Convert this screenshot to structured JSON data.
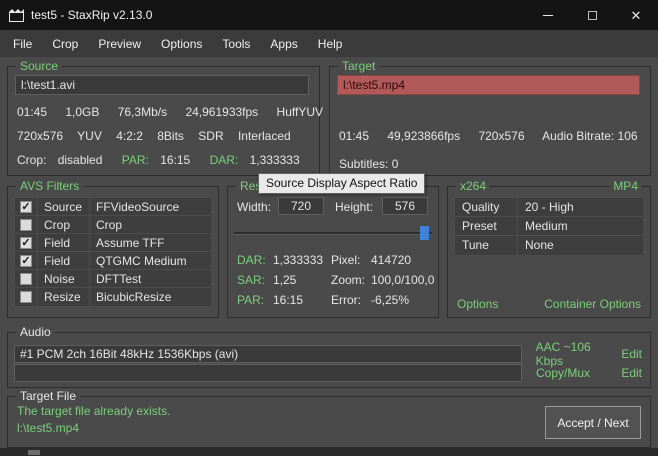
{
  "window": {
    "title": "test5 - StaxRip v2.13.0",
    "close_icon": "✕"
  },
  "menu": {
    "items": [
      "File",
      "Crop",
      "Preview",
      "Options",
      "Tools",
      "Apps",
      "Help"
    ]
  },
  "source": {
    "title": "Source",
    "file": "l:\\test1.avi",
    "info1": [
      "01:45",
      "1,0GB",
      "76,3Mb/s",
      "24,961933fps",
      "HuffYUV"
    ],
    "info2": [
      "720x576",
      "YUV",
      "4:2:2",
      "8Bits",
      "SDR",
      "Interlaced"
    ],
    "crop_label": "Crop:",
    "crop_value": "disabled",
    "par_label": "PAR:",
    "par_value": "16:15",
    "dar_label": "DAR:",
    "dar_value": "1,333333"
  },
  "target": {
    "title": "Target",
    "file": "l:\\test5.mp4",
    "info1": [
      "01:45",
      "49,923866fps",
      "720x576",
      "Audio Bitrate: 106"
    ],
    "subtitles": "Subtitles: 0"
  },
  "filters": {
    "title": "AVS Filters",
    "rows": [
      {
        "check": "✓",
        "name": "Source",
        "value": "FFVideoSource"
      },
      {
        "check": "",
        "name": "Crop",
        "value": "Crop"
      },
      {
        "check": "✓",
        "name": "Field",
        "value": "Assume TFF"
      },
      {
        "check": "✓",
        "name": "Field",
        "value": "QTGMC Medium"
      },
      {
        "check": "",
        "name": "Noise",
        "value": "DFTTest"
      },
      {
        "check": "",
        "name": "Resize",
        "value": "BicubicResize"
      }
    ]
  },
  "resize": {
    "title": "Resize",
    "width_label": "Width:",
    "width_value": "720",
    "height_label": "Height:",
    "height_value": "576",
    "stats": [
      {
        "l1": "DAR:",
        "v1": "1,333333",
        "l2": "Pixel:",
        "v2": "414720"
      },
      {
        "l1": "SAR:",
        "v1": "1,25",
        "l2": "Zoom:",
        "v2": "100,0/100,0"
      },
      {
        "l1": "PAR:",
        "v1": "16:15",
        "l2": "Error:",
        "v2": "-6,25%"
      }
    ]
  },
  "tooltip": "Source Display Aspect Ratio",
  "x264": {
    "title": "x264",
    "container": "MP4",
    "rows": [
      {
        "name": "Quality",
        "value": "20 - High"
      },
      {
        "name": "Preset",
        "value": "Medium"
      },
      {
        "name": "Tune",
        "value": "None"
      }
    ],
    "options": "Options",
    "container_options": "Container Options"
  },
  "audio": {
    "title": "Audio",
    "track1": "#1 PCM 2ch 16Bit 48kHz 1536Kbps (avi)",
    "track1_codec": "AAC ~106 Kbps",
    "track1_edit": "Edit",
    "track2": "",
    "track2_codec": "Copy/Mux",
    "track2_edit": "Edit"
  },
  "target_file": {
    "title": "Target File",
    "message": "The target file already exists.",
    "path": "l:\\test5.mp4",
    "accept": "Accept / Next"
  }
}
